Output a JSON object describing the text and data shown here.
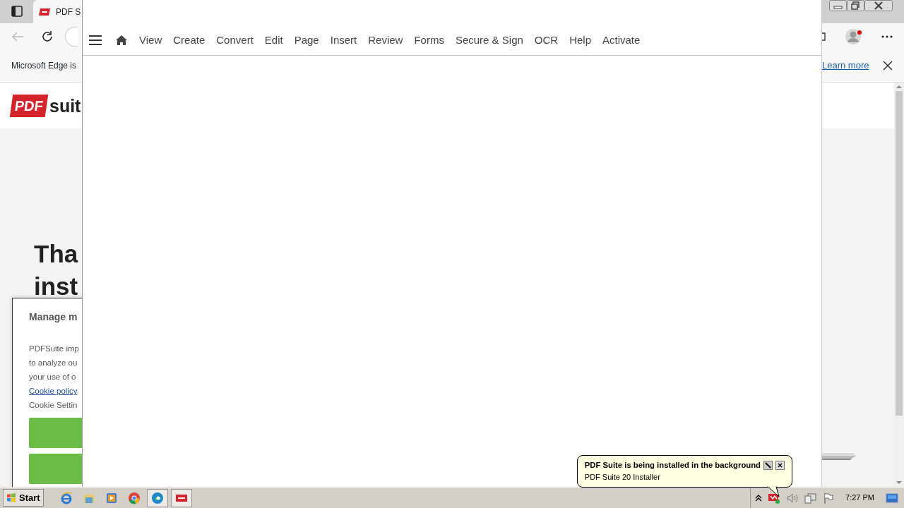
{
  "browser": {
    "tab": {
      "title": "PDF S"
    },
    "infobar": {
      "message": "Microsoft Edge is",
      "link": "Learn more"
    },
    "site": {
      "logo_badge": "PDF",
      "logo_text": "suit",
      "heading_lines": [
        "Tha",
        "inst"
      ]
    },
    "cookie_dialog": {
      "title": "Manage m",
      "lines": [
        "PDFSuite imp",
        "to analyze ou",
        "your use of o"
      ],
      "policy_link": "Cookie policy",
      "settings_line": "Cookie Settin"
    }
  },
  "app": {
    "menu": [
      "View",
      "Create",
      "Convert",
      "Edit",
      "Page",
      "Insert",
      "Review",
      "Forms",
      "Secure & Sign",
      "OCR",
      "Help",
      "Activate"
    ]
  },
  "balloon": {
    "title": "PDF Suite is being installed in the background",
    "subtitle": "PDF Suite 20 Installer"
  },
  "taskbar": {
    "start": "Start",
    "clock": "7:27 PM"
  }
}
